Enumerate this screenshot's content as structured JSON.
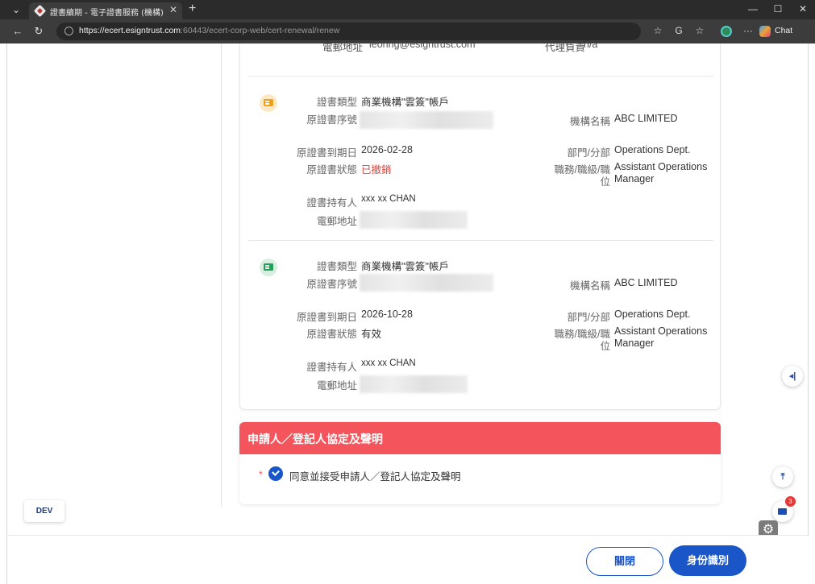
{
  "browser": {
    "tab_title": "證書續期 - 電子證書服務 (機構)",
    "url_host": "https://ecert.esigntrust.com",
    "url_path": ":60443/ecert-corp-web/cert-renewal/renew",
    "chat_label": "Chat"
  },
  "partial_row": {
    "email_label": "電郵地址",
    "email_value": "leonng@esigntrust.com",
    "agent_label": "代理負責",
    "agent_value": "n/a"
  },
  "labels": {
    "cert_type": "證書類型",
    "orig_serial": "原證書序號",
    "org_name": "機構名稱",
    "expiry": "原證書到期日",
    "dept": "部門/分部",
    "status": "原證書狀態",
    "position_a": "職務/職級/職",
    "position_b": "位",
    "holder": "證書持有人",
    "email": "電郵地址"
  },
  "certificates": [
    {
      "icon": "certificate-icon-orange",
      "type": "商業機構\"雲簽\"帳戶",
      "org_name": "ABC LIMITED",
      "expiry": "2026-02-28",
      "dept": "Operations Dept.",
      "status": "已撤銷",
      "status_color": "#e0403a",
      "position_line1": "Assistant Operations",
      "position_line2": "Manager",
      "holder": "xxx xx CHAN"
    },
    {
      "icon": "certificate-icon-green",
      "type": "商業機構\"雲簽\"帳戶",
      "org_name": "ABC LIMITED",
      "expiry": "2026-10-28",
      "dept": "Operations Dept.",
      "status": "有效",
      "status_color": "#333333",
      "position_line1": "Assistant Operations",
      "position_line2": "Manager",
      "holder": "xxx xx CHAN"
    }
  ],
  "declaration": {
    "title": "申請人／登記人協定及聲明",
    "agree_text": "同意並接受申請人／登記人協定及聲明",
    "checked": true
  },
  "dev_label": "DEV",
  "notification_count": "3",
  "footer": {
    "close_label": "關閉",
    "identify_label": "身份識別"
  },
  "colors": {
    "accent": "#1a56c7",
    "declaration_header": "#f4545b"
  }
}
